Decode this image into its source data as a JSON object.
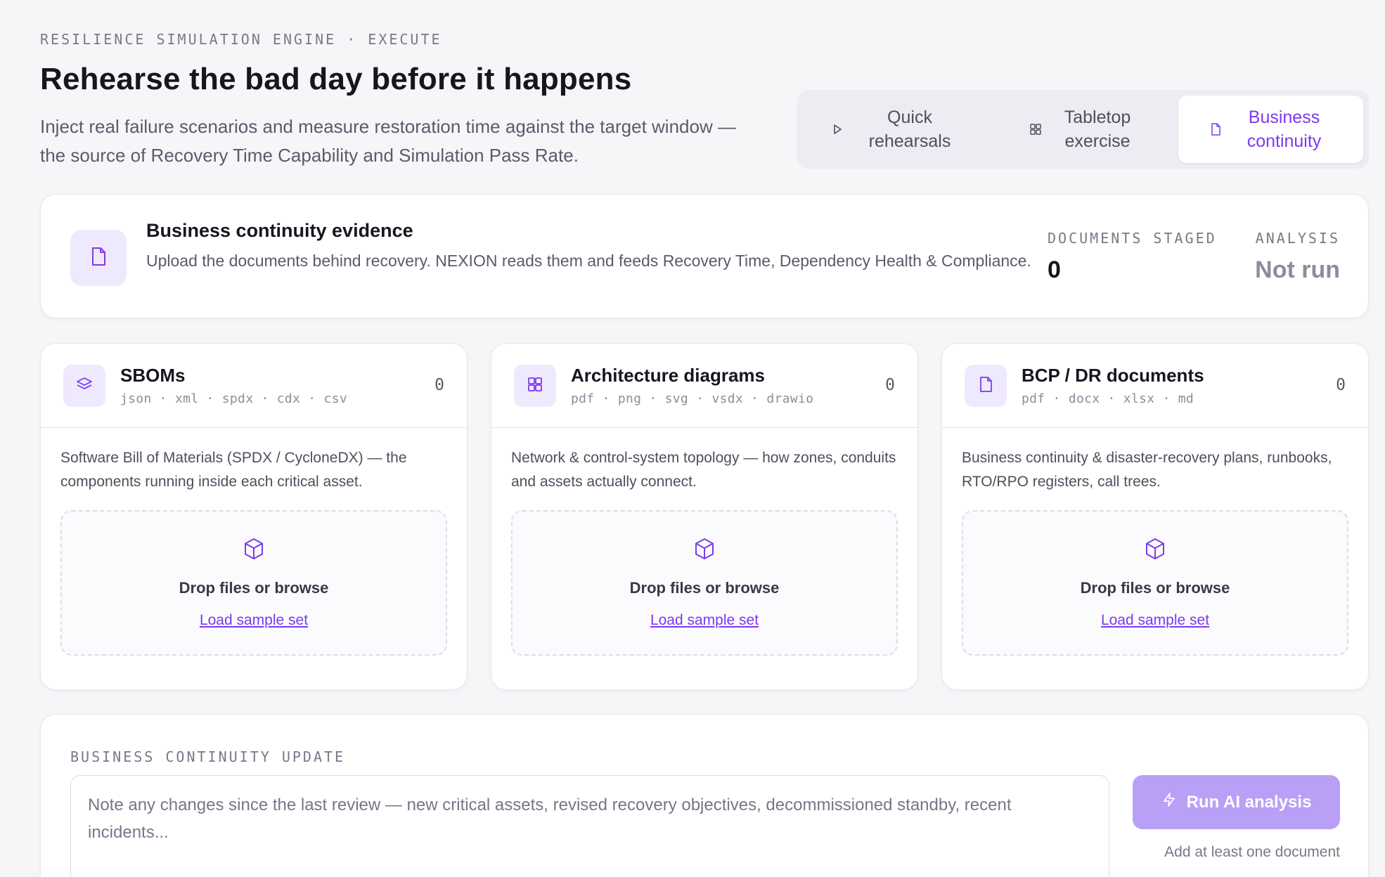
{
  "header": {
    "eyebrow": "RESILIENCE SIMULATION ENGINE · EXECUTE",
    "title": "Rehearse the bad day before it happens",
    "subtitle": "Inject real failure scenarios and measure restoration time against the target window — the source of Recovery Time Capability and Simulation Pass Rate."
  },
  "tabs": [
    {
      "label": "Quick rehearsals",
      "icon": "play-icon"
    },
    {
      "label": "Tabletop exercise",
      "icon": "grid-icon"
    },
    {
      "label": "Business continuity",
      "icon": "document-icon",
      "active": true
    }
  ],
  "evidence": {
    "title": "Business continuity evidence",
    "description": "Upload the documents behind recovery. NEXION reads them and feeds Recovery Time, Dependency Health & Compliance.",
    "docs_label": "DOCUMENTS STAGED",
    "docs_value": "0",
    "analysis_label": "ANALYSIS",
    "analysis_value": "Not run"
  },
  "uploads": [
    {
      "title": "SBOMs",
      "formats": "json · xml · spdx · cdx · csv",
      "count": "0",
      "description": "Software Bill of Materials (SPDX / CycloneDX) — the components running inside each critical asset.",
      "drop_text": "Drop files or browse",
      "sample_link": "Load sample set",
      "icon": "layers-icon"
    },
    {
      "title": "Architecture diagrams",
      "formats": "pdf · png · svg · vsdx · drawio",
      "count": "0",
      "description": "Network & control-system topology — how zones, conduits and assets actually connect.",
      "drop_text": "Drop files or browse",
      "sample_link": "Load sample set",
      "icon": "grid-icon"
    },
    {
      "title": "BCP / DR documents",
      "formats": "pdf · docx · xlsx · md",
      "count": "0",
      "description": "Business continuity & disaster-recovery plans, runbooks, RTO/RPO registers, call trees.",
      "drop_text": "Drop files or browse",
      "sample_link": "Load sample set",
      "icon": "document-icon"
    }
  ],
  "update": {
    "label": "BUSINESS CONTINUITY UPDATE",
    "placeholder": "Note any changes since the last review — new critical assets, revised recovery objectives, decommissioned standby, recent incidents...",
    "run_label": "Run AI analysis",
    "hint": "Add at least one document"
  },
  "colors": {
    "accent": "#7c3aed",
    "accent_soft": "#efe9fd",
    "button_disabled": "#b9a0f6",
    "background": "#f6f6f9"
  }
}
